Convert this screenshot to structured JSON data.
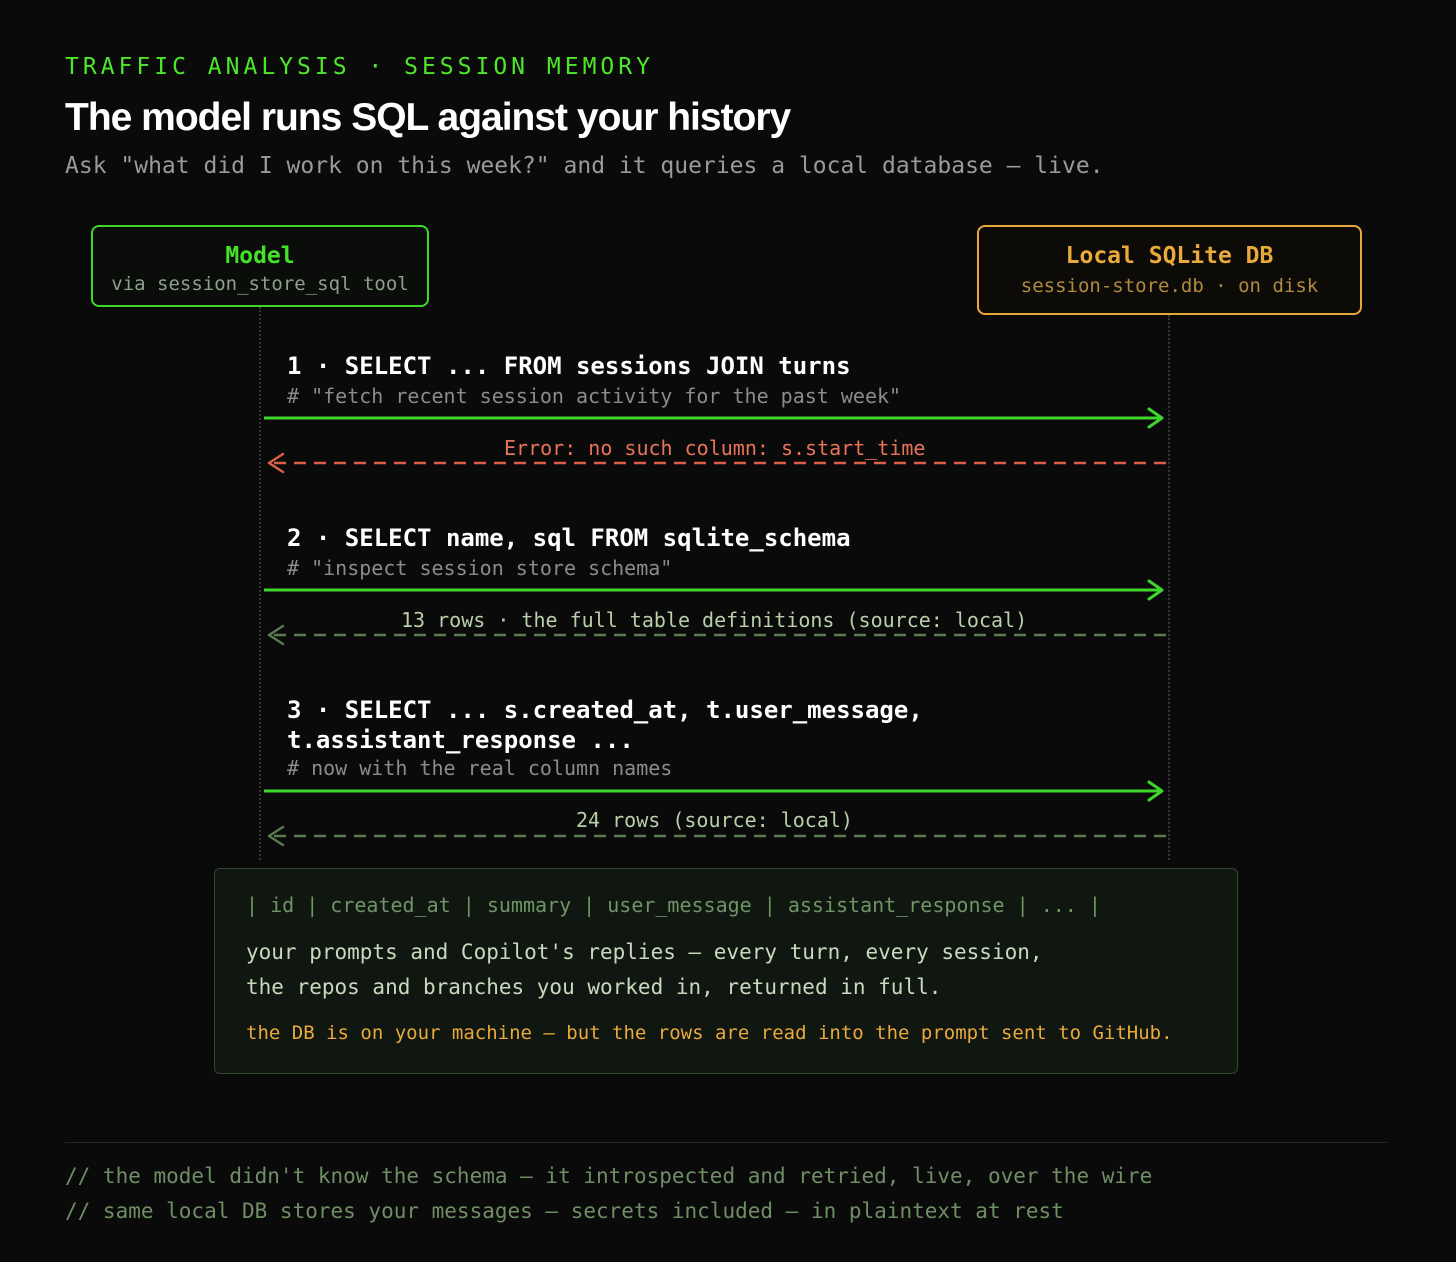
{
  "header": {
    "eyebrow": "TRAFFIC ANALYSIS · SESSION MEMORY",
    "title": "The model runs SQL against your history",
    "subtitle": "Ask \"what did I work on this week?\" and it queries a local database — live."
  },
  "actors": {
    "model": {
      "name": "Model",
      "meta": "via session_store_sql tool"
    },
    "db": {
      "name": "Local SQLite DB",
      "meta": "session-store.db · on disk"
    }
  },
  "steps": [
    {
      "query_lines": [
        "1 · SELECT ... FROM sessions JOIN turns"
      ],
      "comment": "# \"fetch recent session activity for the past week\"",
      "response": "Error: no such column: s.start_time",
      "status": "error"
    },
    {
      "query_lines": [
        "2 · SELECT name, sql FROM sqlite_schema"
      ],
      "comment": "# \"inspect session store schema\"",
      "response": "13 rows · the full table definitions (source: local)",
      "status": "ok"
    },
    {
      "query_lines": [
        "3 · SELECT ... s.created_at, t.user_message,",
        "t.assistant_response ..."
      ],
      "comment": "# now with the real column names",
      "response": "24 rows (source: local)",
      "status": "ok"
    }
  ],
  "result": {
    "columns_line": "| id | created_at | summary | user_message | assistant_response | ... |",
    "body_lines": [
      "your prompts and Copilot's replies — every turn, every session,",
      "the repos and branches you worked in, returned in full."
    ],
    "warning": "the DB is on your machine — but the rows are read into the prompt sent to GitHub."
  },
  "footer": [
    "// the model didn't know the schema — it introspected and retried, live, over the wire",
    "// same local DB stores your messages — secrets included — in plaintext at rest"
  ],
  "colors": {
    "background": "#0a0a0a",
    "accent_green": "#44e12a",
    "accent_amber": "#e9a93b",
    "error_red": "#e8735a",
    "muted_green": "#6f8e66"
  }
}
